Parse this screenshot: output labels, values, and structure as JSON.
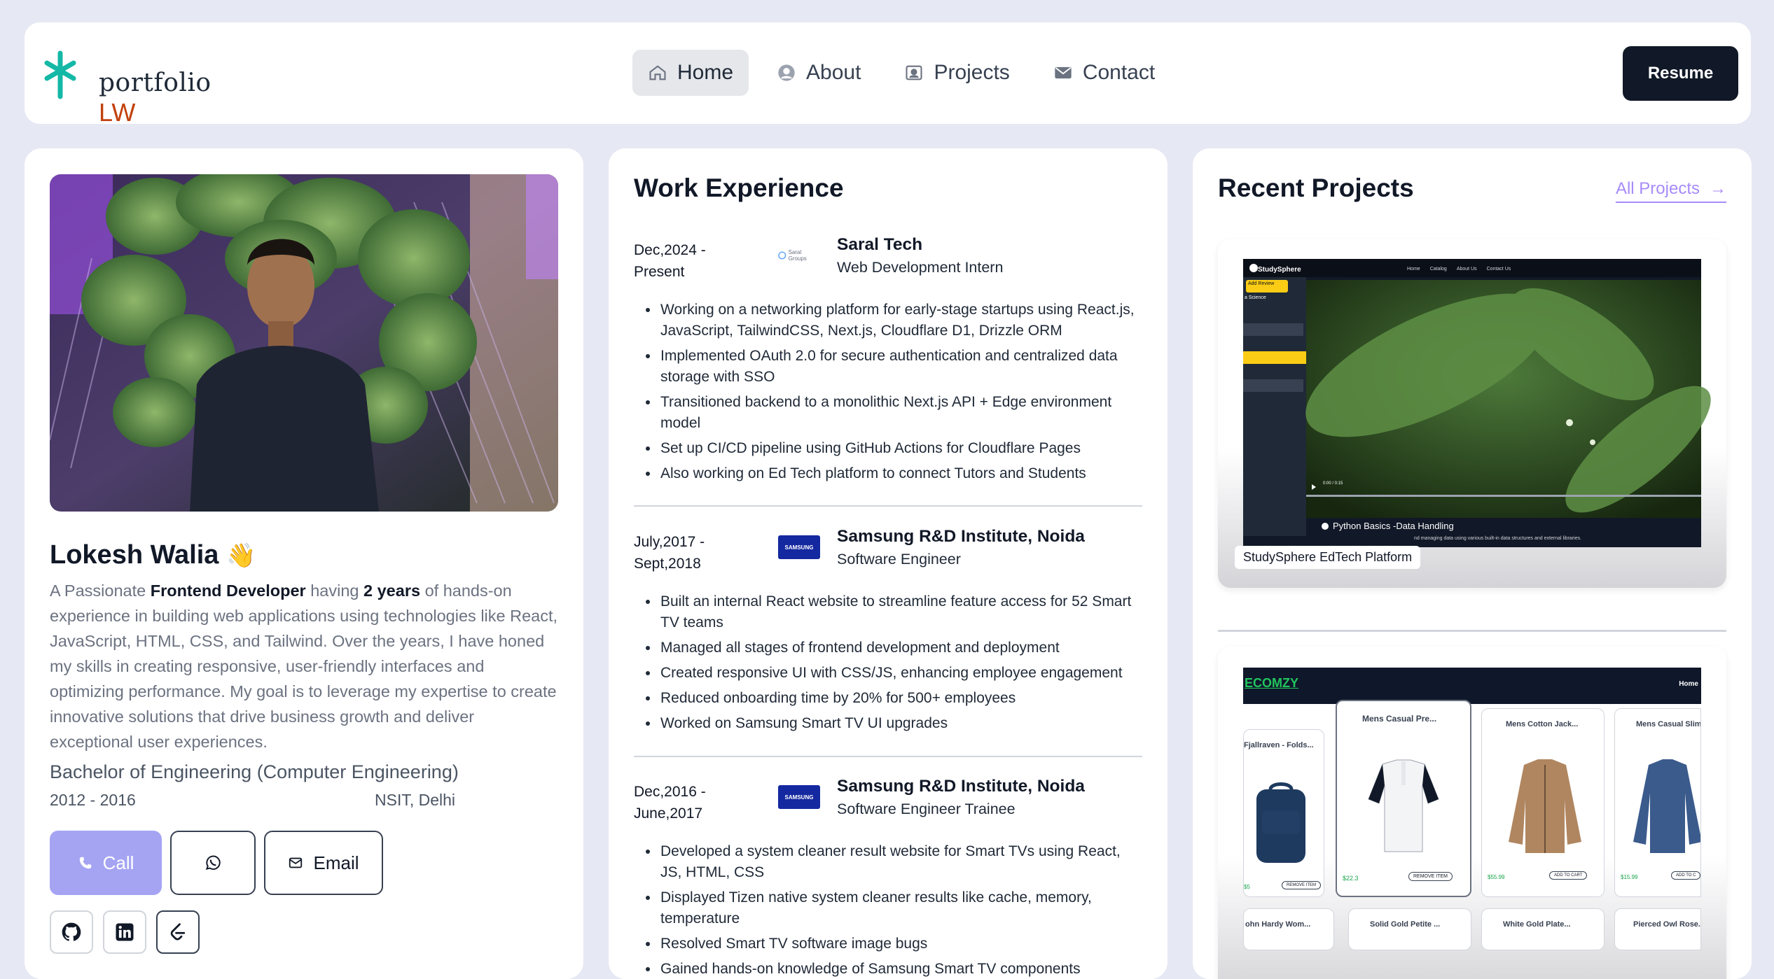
{
  "brand": {
    "line1": "portfolio",
    "line2": "LW"
  },
  "nav": {
    "items": [
      {
        "label": "Home",
        "icon": "home-icon"
      },
      {
        "label": "About",
        "icon": "user-circle-icon"
      },
      {
        "label": "Projects",
        "icon": "id-card-icon"
      },
      {
        "label": "Contact",
        "icon": "envelope-icon"
      }
    ],
    "resume_label": "Resume"
  },
  "profile": {
    "name": "Lokesh Walia",
    "wave": "👋",
    "bio_pre": "A Passionate ",
    "bio_role": "Frontend Developer",
    "bio_mid": " having ",
    "bio_years": "2 years",
    "bio_post": " of hands-on experience in building web applications using technologies like React, JavaScript, HTML, CSS, and Tailwind. Over the years, I have honed my skills in creating responsive, user-friendly interfaces and optimizing performance. My goal is to leverage my expertise to create innovative solutions that drive business growth and deliver exceptional user experiences.",
    "degree": "Bachelor of Engineering (Computer Engineering)",
    "years": "2012 - 2016",
    "college": "NSIT, Delhi",
    "call_label": "Call",
    "email_label": "Email"
  },
  "work": {
    "title": "Work Experience",
    "jobs": [
      {
        "date1": "Dec,2024 -",
        "date2": "Present",
        "company": "Saral Tech",
        "role": "Web Development Intern",
        "logo_text": "Saral Groups",
        "bullets": [
          "Working on a networking platform for early-stage startups using React.js, JavaScript, TailwindCSS, Next.js, Cloudflare D1, Drizzle ORM",
          "Implemented OAuth 2.0 for secure authentication and centralized data storage with SSO",
          "Transitioned backend to a monolithic Next.js API + Edge environment model",
          "Set up CI/CD pipeline using GitHub Actions for Cloudflare Pages",
          "Also working on Ed Tech platform to connect Tutors and Students"
        ]
      },
      {
        "date1": "July,2017 -",
        "date2": "Sept,2018",
        "company": "Samsung R&D Institute, Noida",
        "role": "Software Engineer",
        "logo_text": "SAMSUNG",
        "bullets": [
          "Built an internal React website to streamline feature access for 52 Smart TV teams",
          "Managed all stages of frontend development and deployment",
          "Created responsive UI with CSS/JS, enhancing employee engagement",
          "Reduced onboarding time by 20% for 500+ employees",
          "Worked on Samsung Smart TV UI upgrades"
        ]
      },
      {
        "date1": "Dec,2016 -",
        "date2": "June,2017",
        "company": "Samsung R&D Institute, Noida",
        "role": "Software Engineer Trainee",
        "logo_text": "SAMSUNG",
        "bullets": [
          "Developed a system cleaner result website for Smart TVs using React, JS, HTML, CSS",
          "Displayed Tizen native system cleaner results like cache, memory, temperature",
          "Resolved Smart TV software image bugs",
          "Gained hands-on knowledge of Samsung Smart TV components"
        ]
      }
    ]
  },
  "projects": {
    "title": "Recent Projects",
    "all_label": "All Projects",
    "arrow": "→",
    "p1": {
      "caption": "StudySphere EdTech Platform",
      "brand": "StudySphere",
      "menu": [
        "Home",
        "Catalog",
        "About Us",
        "Contact Us"
      ],
      "add_review": "Add Review",
      "side_label": "a Science",
      "video_title": "Python Basics -Data Handling",
      "video_sub": "nd managing data using various built-in data structures and external libraries.",
      "time": "0:00 / 0:15"
    },
    "p2": {
      "brand": "ECOMZY",
      "menu": "Home",
      "products": [
        {
          "name": "Fjallraven - Folds...",
          "price": "$5",
          "btn": "REMOVE ITEM"
        },
        {
          "name": "Mens Casual Pre...",
          "price": "$22.3",
          "btn": "REMOVE ITEM"
        },
        {
          "name": "Mens Cotton Jack...",
          "price": "$55.99",
          "btn": "ADD TO CART"
        },
        {
          "name": "Mens Casual Slim...",
          "price": "$15.99",
          "btn": "ADD TO C"
        }
      ],
      "row2": [
        "ohn Hardy Wom...",
        "Solid Gold Petite ...",
        "White Gold Plate...",
        "Pierced Owl Rose..."
      ]
    }
  }
}
